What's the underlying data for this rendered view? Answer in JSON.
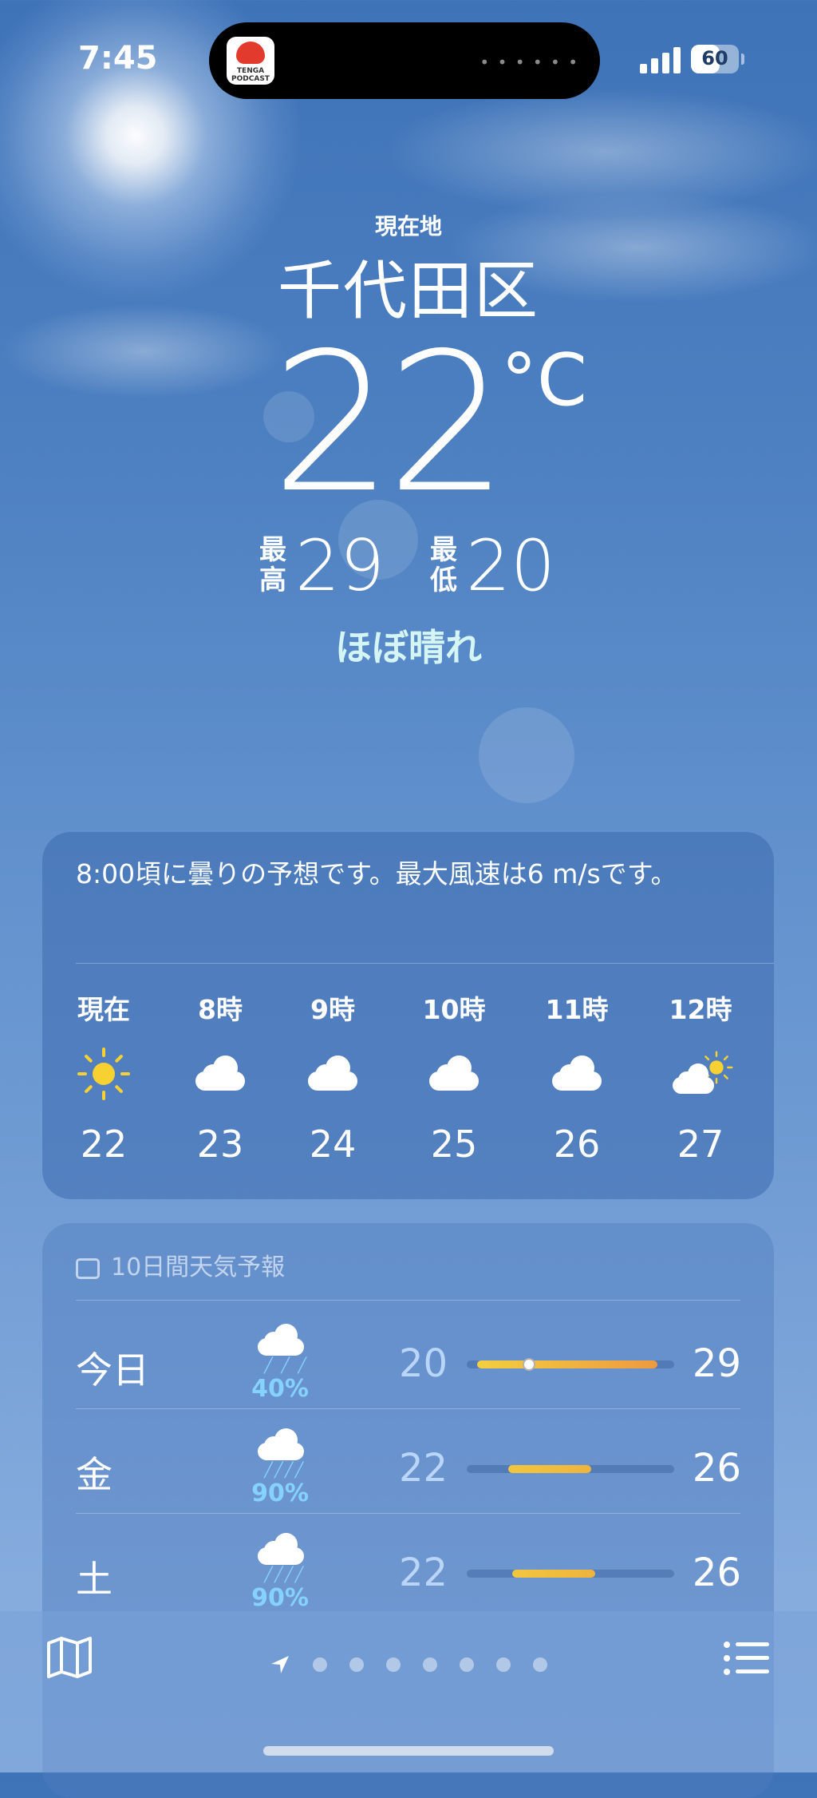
{
  "status_bar": {
    "time": "7:45",
    "battery": "60",
    "battery_level": 0.6,
    "signal_bars": 4,
    "island_app": {
      "name": "TENGA",
      "subtitle": "PODCAST",
      "logo_text": "TENGA",
      "logo_sub": "PODCAST"
    }
  },
  "location": {
    "label": "現在地",
    "name": "千代田区"
  },
  "current": {
    "temperature": "22",
    "unit": "°C",
    "high_label": "最高",
    "high": "29",
    "low_label": "最低",
    "low": "20",
    "condition": "ほぼ晴れ"
  },
  "hourly": {
    "summary": "8:00頃に曇りの予想です。最大風速は6 m/sです。",
    "hours": [
      {
        "label": "現在",
        "icon": "sun-icon",
        "temp": "22"
      },
      {
        "label": "8時",
        "icon": "cloud-icon",
        "temp": "23"
      },
      {
        "label": "9時",
        "icon": "cloud-icon",
        "temp": "24"
      },
      {
        "label": "10時",
        "icon": "cloud-icon",
        "temp": "25"
      },
      {
        "label": "11時",
        "icon": "cloud-icon",
        "temp": "26"
      },
      {
        "label": "12時",
        "icon": "partly-sunny-icon",
        "temp": "27"
      }
    ]
  },
  "daily": {
    "title": "10日間天気予報",
    "days": [
      {
        "day": "今日",
        "icon": "rain-cloud-icon",
        "precip": "40%",
        "low": "20",
        "high": "29",
        "range_start": 0.05,
        "range_end": 0.92,
        "current": 0.3,
        "bar_colors": [
          "#f3cf3f",
          "#ee9a40"
        ]
      },
      {
        "day": "金",
        "icon": "heavy-rain-icon",
        "precip": "90%",
        "low": "22",
        "high": "26",
        "range_start": 0.2,
        "range_end": 0.6,
        "bar_colors": [
          "#f2c63f",
          "#eeb43d"
        ]
      },
      {
        "day": "土",
        "icon": "heavy-rain-icon",
        "precip": "90%",
        "low": "22",
        "high": "26",
        "range_start": 0.22,
        "range_end": 0.62,
        "bar_colors": [
          "#f2c63f",
          "#eeb43d"
        ]
      }
    ]
  },
  "bottom_bar": {
    "page_count": 7
  },
  "colors": {
    "condition_text": "#d4f5f3",
    "precip_text": "#86d2ff",
    "sun": "#f7d131"
  }
}
